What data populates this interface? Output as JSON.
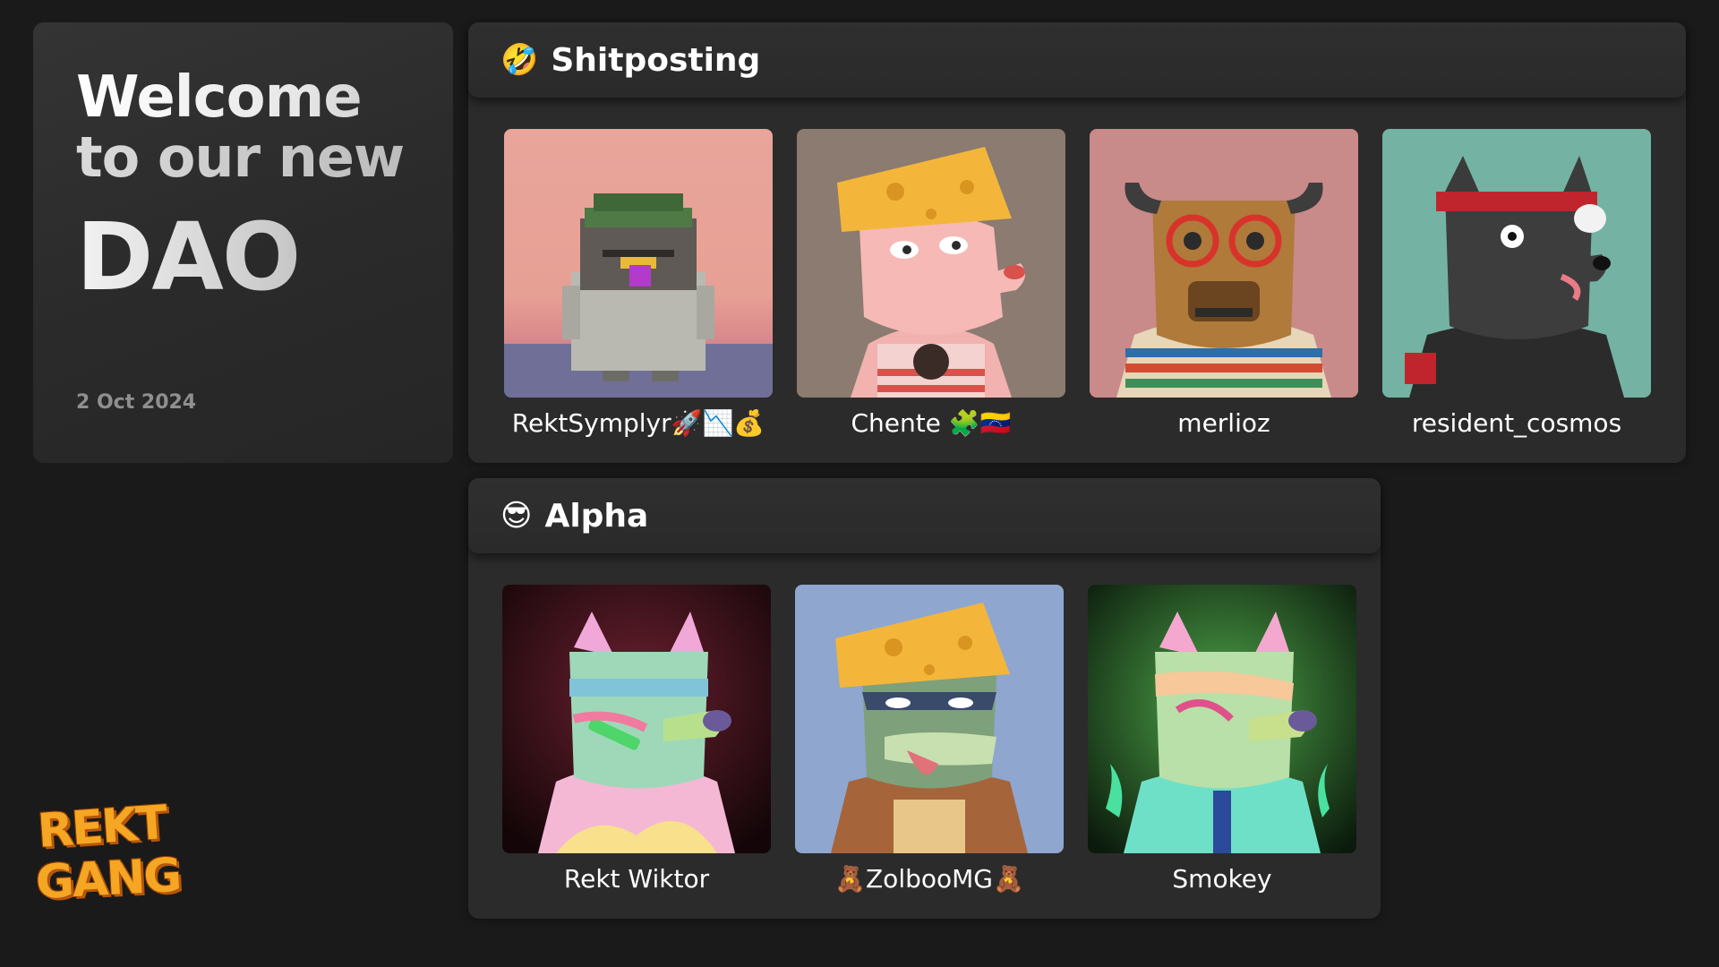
{
  "welcome": {
    "line1": "Welcome",
    "line2": "to our new",
    "line3": "DAO",
    "date": "2 Oct 2024"
  },
  "channels": [
    {
      "emoji": "🤣",
      "title": "Shitposting",
      "members": [
        {
          "name": "RektSymplyr🚀📉💰",
          "avatar_bg": "#e8a79e",
          "avatar_icon": "pixel-duck-avatar"
        },
        {
          "name": "Chente 🧩🇻🇪",
          "avatar_bg": "#8b7b70",
          "avatar_icon": "cheese-hat-dog-avatar"
        },
        {
          "name": "merlioz",
          "avatar_bg": "#c98a8a",
          "avatar_icon": "bull-glasses-avatar"
        },
        {
          "name": "resident_cosmos",
          "avatar_bg": "#74b3a3",
          "avatar_icon": "black-wolf-avatar"
        }
      ]
    },
    {
      "emoji": "😎",
      "title": "Alpha",
      "members": [
        {
          "name": "Rekt Wiktor",
          "avatar_bg": "#3a1418",
          "avatar_icon": "rainbow-wolf-avatar"
        },
        {
          "name": "🧸ZolbooMG🧸",
          "avatar_bg": "#8fa6cf",
          "avatar_icon": "cheese-hat-croc-avatar"
        },
        {
          "name": "Smokey",
          "avatar_bg": "#0f2a14",
          "avatar_icon": "green-flame-wolf-avatar"
        }
      ]
    }
  ],
  "logo": {
    "line1": "REKT",
    "line2": "GANG"
  },
  "colors": {
    "page_bg": "#1a1a1a",
    "panel_bg": "#2b2b2b",
    "accent_logo": "#f5a623"
  }
}
